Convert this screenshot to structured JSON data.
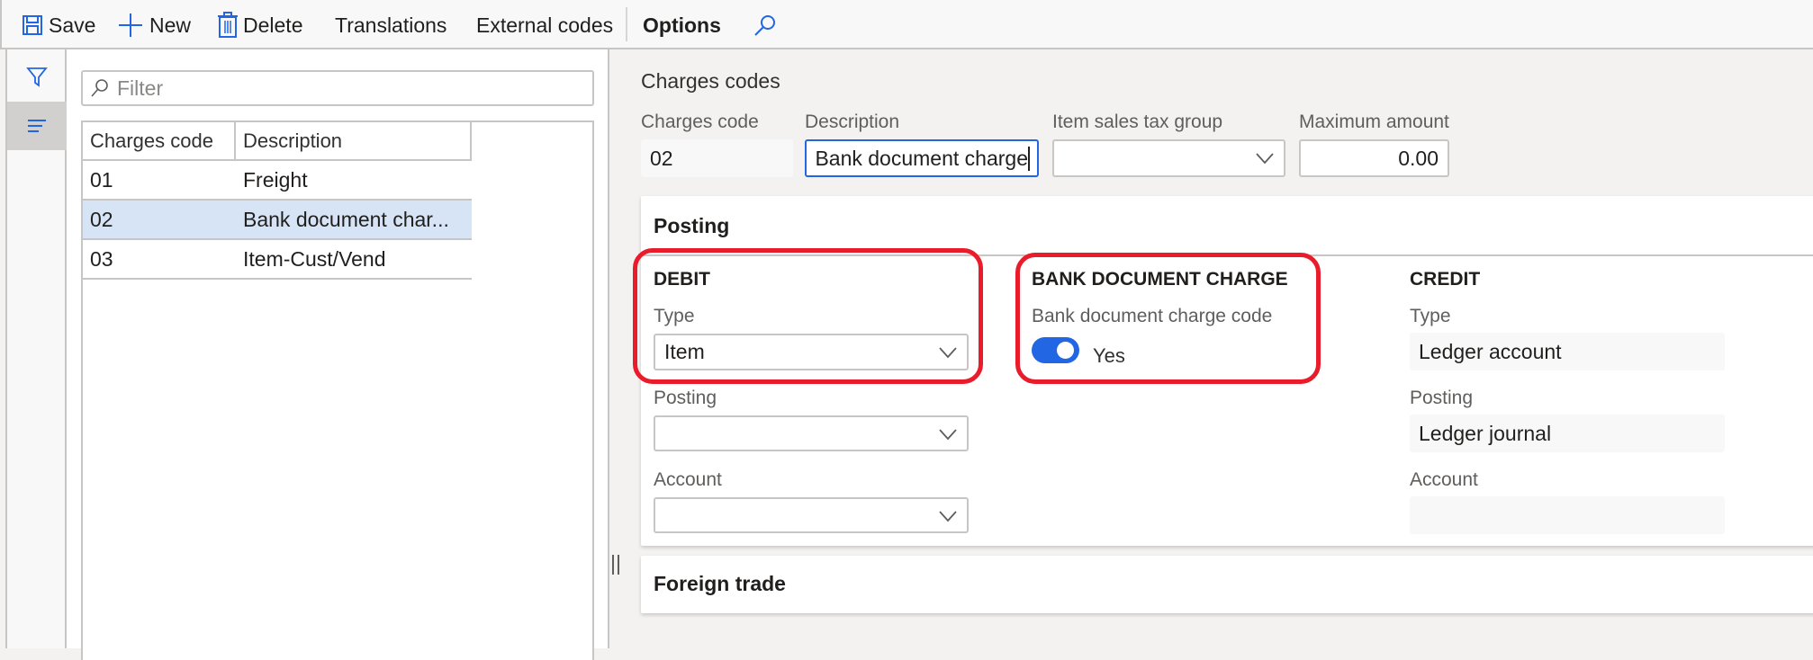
{
  "toolbar": {
    "save": "Save",
    "new": "New",
    "delete": "Delete",
    "translations": "Translations",
    "external_codes": "External codes",
    "options": "Options",
    "search_icon": "search-icon"
  },
  "rail": {
    "items": [
      {
        "icon": "filter-icon"
      },
      {
        "icon": "list-icon",
        "active": true
      }
    ]
  },
  "list": {
    "filter_placeholder": "Filter",
    "columns": [
      "Charges code",
      "Description"
    ],
    "rows": [
      {
        "code": "01",
        "description": "Freight"
      },
      {
        "code": "02",
        "description": "Bank document char...",
        "selected": true
      },
      {
        "code": "03",
        "description": "Item-Cust/Vend"
      }
    ]
  },
  "header": {
    "title": "Charges codes",
    "fields": {
      "charges_code": {
        "label": "Charges code",
        "value": "02"
      },
      "description": {
        "label": "Description",
        "value": "Bank document charge"
      },
      "item_sales_tax_group": {
        "label": "Item sales tax group",
        "value": ""
      },
      "maximum_amount": {
        "label": "Maximum amount",
        "value": "0.00"
      }
    }
  },
  "posting": {
    "title": "Posting",
    "debit": {
      "title": "DEBIT",
      "type": {
        "label": "Type",
        "value": "Item"
      },
      "posting": {
        "label": "Posting",
        "value": ""
      },
      "account": {
        "label": "Account",
        "value": ""
      }
    },
    "bank_document_charge": {
      "title": "BANK DOCUMENT CHARGE",
      "code_label": "Bank document charge code",
      "toggle_on": true,
      "toggle_text": "Yes"
    },
    "credit": {
      "title": "CREDIT",
      "type": {
        "label": "Type",
        "value": "Ledger account"
      },
      "posting": {
        "label": "Posting",
        "value": "Ledger journal"
      },
      "account": {
        "label": "Account",
        "value": ""
      }
    }
  },
  "foreign_trade": {
    "title": "Foreign trade"
  },
  "colors": {
    "accent": "#2266e3",
    "highlight_box": "#e81c2a",
    "selected_row": "#d6e4f6"
  }
}
